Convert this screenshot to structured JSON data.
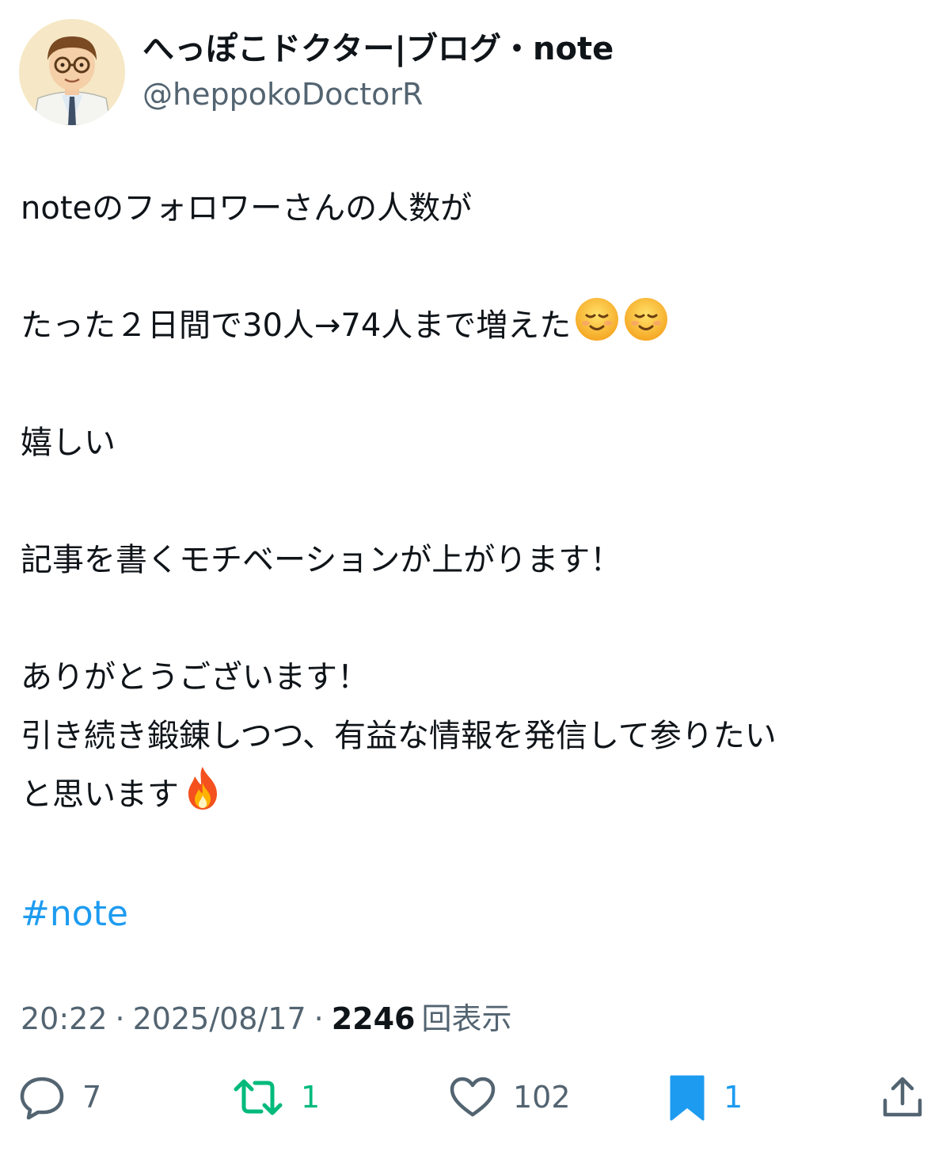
{
  "author": {
    "display_name": "へっぽこドクター|ブログ・note",
    "handle": "@heppokoDoctorR"
  },
  "tweet": {
    "lines": [
      "noteのフォロワーさんの人数が",
      "",
      "たった２日間で30人→74人まで増えた",
      "",
      "嬉しい",
      "",
      "記事を書くモチベーションが上がります！",
      "",
      "ありがとうございます！",
      "引き続き鍛錬しつつ、有益な情報を発信して参りたい",
      "と思います"
    ],
    "hashtag": "#note"
  },
  "meta": {
    "time": "20:22",
    "date": "2025/08/17",
    "separator": "·",
    "views_count": "2246",
    "views_label": "回表示"
  },
  "actions": {
    "reply_count": "7",
    "retweet_count": "1",
    "like_count": "102",
    "bookmark_count": "1"
  },
  "colors": {
    "text": "#0f1419",
    "secondary": "#536471",
    "link": "#1d9bf0",
    "retweet_active": "#00ba7c",
    "bookmark_active": "#1d9bf0"
  },
  "icons": {
    "smile": "smiling-face-icon",
    "fire": "fire-icon",
    "reply": "reply-icon",
    "retweet": "retweet-icon",
    "like": "heart-icon",
    "bookmark": "bookmark-icon",
    "share": "share-icon"
  }
}
